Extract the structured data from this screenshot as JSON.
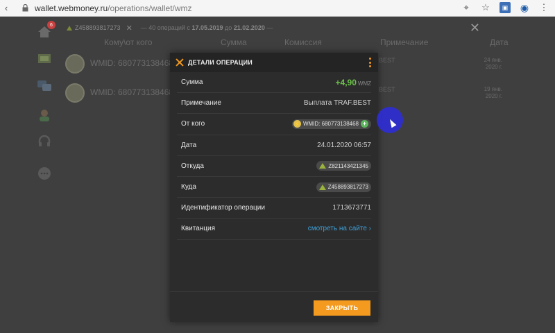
{
  "browser": {
    "url_host": "wallet.webmoney.ru",
    "url_path": "/operations/wallet/wmz"
  },
  "sidebar": {
    "badge": "6"
  },
  "filter": {
    "purse": "Z458893817273",
    "prefix": "40 операций с",
    "date_from": "17.05.2019",
    "mid": "до",
    "date_to": "21.02.2020"
  },
  "columns": {
    "counterparty": "Кому\\от кого",
    "amount": "Сумма",
    "fee": "Комиссия",
    "note": "Примечание",
    "date": "Дата"
  },
  "rows": [
    {
      "wmid": "WMID: 680773138468",
      "note": "BEST",
      "date_line1": "24 янв.",
      "date_line2": "2020 г."
    },
    {
      "wmid": "WMID: 680773138468",
      "note": "BEST",
      "date_line1": "19 янв.",
      "date_line2": "2020 г."
    }
  ],
  "modal": {
    "title": "ДЕТАЛИ ОПЕРАЦИИ",
    "amount_label": "Сумма",
    "amount_value": "+4,90",
    "amount_currency": "WMZ",
    "note_label": "Примечание",
    "note_value": "Выплата TRAF.BEST",
    "from_label": "От кого",
    "from_value": "WMID: 680773138468",
    "date_label": "Дата",
    "date_value": "24.01.2020 06:57",
    "source_label": "Откуда",
    "source_value": "Z821143421345",
    "dest_label": "Куда",
    "dest_value": "Z458893817273",
    "opid_label": "Идентификатор операции",
    "opid_value": "1713673771",
    "receipt_label": "Квитанция",
    "receipt_link": "смотреть на сайте ›",
    "close_button": "ЗАКРЫТЬ"
  },
  "colors": {
    "accent": "#f39a1f",
    "positive": "#6cc24a",
    "link": "#3ea0d8"
  }
}
